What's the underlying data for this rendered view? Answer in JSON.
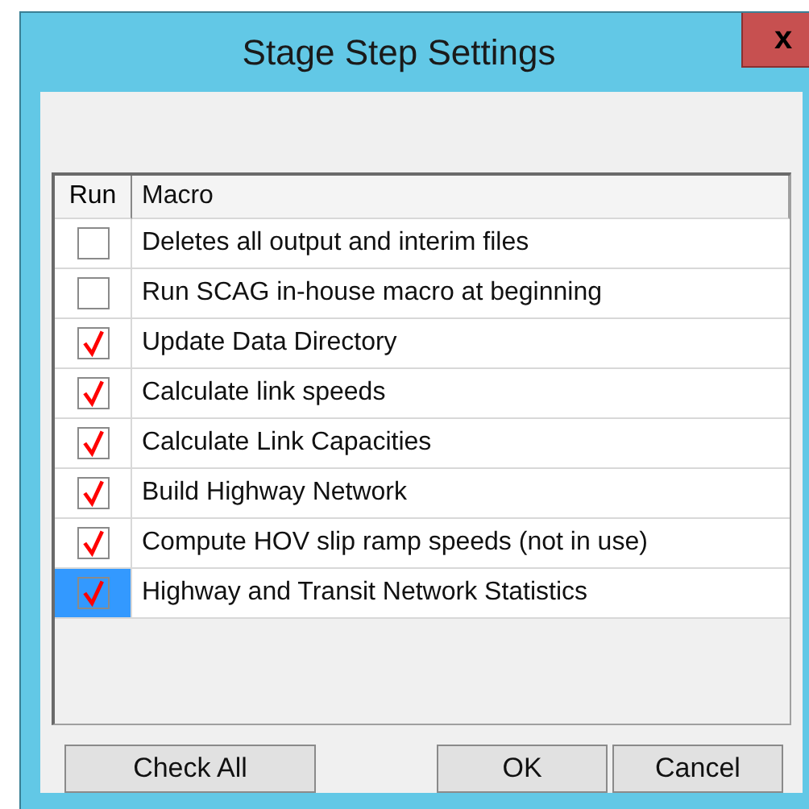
{
  "window": {
    "title": "Stage Step Settings",
    "close": "x"
  },
  "table": {
    "columns": [
      "Run",
      "Macro"
    ],
    "rows": [
      {
        "macro": "Deletes all output and interim files",
        "checked": false,
        "selected": false
      },
      {
        "macro": "Run SCAG in-house macro at beginning",
        "checked": false,
        "selected": false
      },
      {
        "macro": "Update Data Directory",
        "checked": true,
        "selected": false
      },
      {
        "macro": "Calculate link speeds",
        "checked": true,
        "selected": false
      },
      {
        "macro": "Calculate Link Capacities",
        "checked": true,
        "selected": false
      },
      {
        "macro": "Build Highway Network",
        "checked": true,
        "selected": false
      },
      {
        "macro": "Compute HOV slip ramp speeds (not in use)",
        "checked": true,
        "selected": false
      },
      {
        "macro": "Highway and Transit Network Statistics",
        "checked": true,
        "selected": true
      }
    ]
  },
  "buttons": [
    "Check All",
    "OK",
    "Cancel"
  ]
}
